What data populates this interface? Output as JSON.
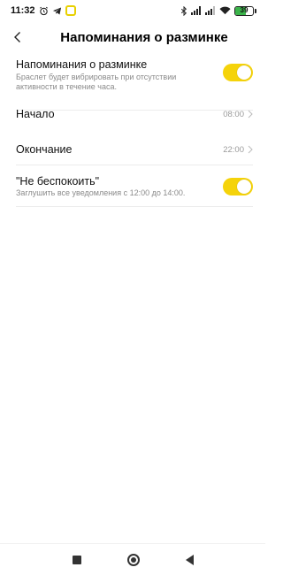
{
  "status_bar": {
    "time": "11:32",
    "left_icons": [
      "alarm-clock-icon",
      "telegram-icon",
      "notification-app-icon"
    ],
    "right_icons": [
      "bluetooth-icon",
      "signal-icon",
      "signal-icon",
      "wifi-icon"
    ],
    "battery_level": "39",
    "battery_color": "#3bb44a"
  },
  "header": {
    "title": "Напоминания о разминке",
    "back_icon": "chevron-left-icon"
  },
  "settings": {
    "reminders": {
      "title": "Напоминания о разминке",
      "subtitle": "Браслет будет вибрировать при отсутствии активности в течение часа.",
      "enabled": true
    },
    "start": {
      "title": "Начало",
      "value": "08:00"
    },
    "end": {
      "title": "Окончание",
      "value": "22:00"
    },
    "dnd": {
      "title": "\"Не беспокоить\"",
      "subtitle": "Заглушить все уведомления с 12:00 до 14:00.",
      "enabled": true
    }
  },
  "nav_bar": {
    "buttons": [
      "recent-apps-icon",
      "home-icon",
      "back-triangle-icon"
    ]
  },
  "colors": {
    "accent": "#f5d30a",
    "divider": "#ececec",
    "secondary_text": "#8a8a8a"
  }
}
